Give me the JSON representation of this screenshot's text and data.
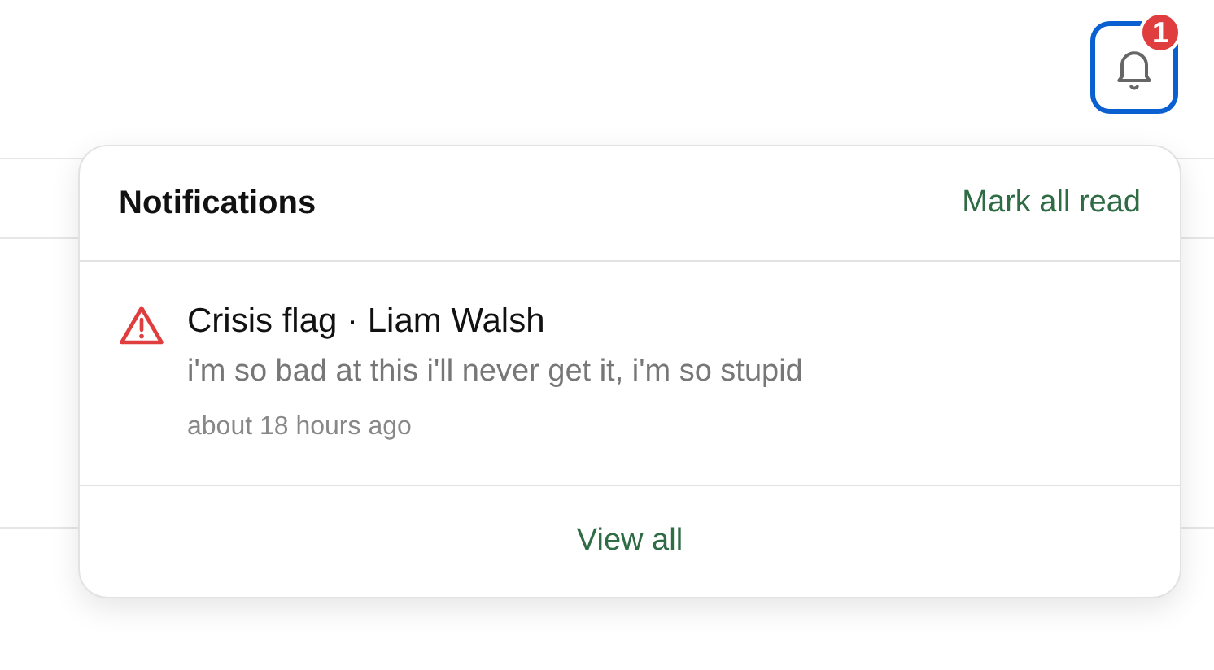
{
  "bell": {
    "badge": "1"
  },
  "notifications": {
    "title": "Notifications",
    "mark_all": "Mark all read",
    "items": [
      {
        "kind": "crisis",
        "title": "Crisis flag · Liam Walsh",
        "message": "i'm so bad at this i'll never get it, i'm so stupid",
        "time": "about 18 hours ago"
      }
    ],
    "footer": "View all"
  }
}
